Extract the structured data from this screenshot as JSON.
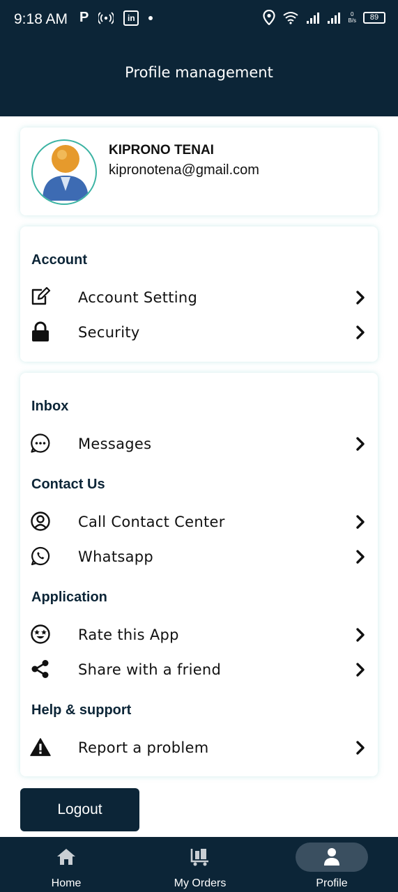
{
  "status_bar": {
    "time": "9:18 AM",
    "p_glyph": "P",
    "linkedin": "in",
    "speed_value": "0",
    "speed_unit": "B/s",
    "battery": "89"
  },
  "appbar": {
    "title": "Profile management"
  },
  "profile": {
    "name": "KIPRONO TENAI",
    "email": "kipronotena@gmail.com"
  },
  "account": {
    "title": "Account",
    "items": [
      {
        "label": "Account Setting",
        "icon": "edit-icon"
      },
      {
        "label": "Security",
        "icon": "lock-icon"
      }
    ]
  },
  "inbox": {
    "title": "Inbox",
    "items": [
      {
        "label": "Messages",
        "icon": "chat-bubble-icon"
      }
    ]
  },
  "contact": {
    "title": "Contact Us",
    "items": [
      {
        "label": "Call Contact Center",
        "icon": "user-circle-icon"
      },
      {
        "label": "Whatsapp",
        "icon": "whatsapp-icon"
      }
    ]
  },
  "application": {
    "title": "Application",
    "items": [
      {
        "label": "Rate this App",
        "icon": "star-eyes-smiley-icon"
      },
      {
        "label": "Share with a friend",
        "icon": "share-icon"
      }
    ]
  },
  "help": {
    "title": "Help & support",
    "items": [
      {
        "label": "Report a problem",
        "icon": "warning-icon"
      }
    ]
  },
  "logout_label": "Logout",
  "bottom_nav": {
    "items": [
      {
        "label": "Home",
        "icon": "home-icon"
      },
      {
        "label": "My Orders",
        "icon": "orders-cart-icon"
      },
      {
        "label": "Profile",
        "icon": "person-icon",
        "active": true
      }
    ]
  },
  "colors": {
    "primary": "#0c2537",
    "avatar_ring": "#3bb3a3",
    "active_pill": "#3a4f60"
  }
}
